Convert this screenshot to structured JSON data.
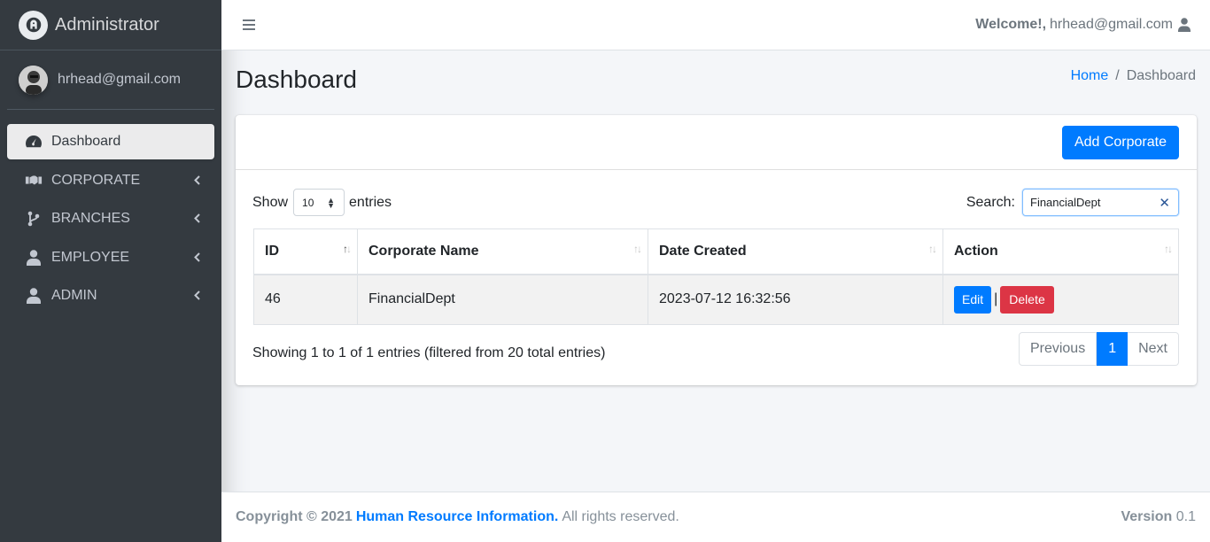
{
  "brand": {
    "name": "Administrator"
  },
  "user": {
    "email": "hrhead@gmail.com"
  },
  "sidebar": {
    "items": [
      {
        "label": "Dashboard",
        "icon": "tachometer-icon"
      },
      {
        "label": "CORPORATE",
        "icon": "handshake-icon"
      },
      {
        "label": "BRANCHES",
        "icon": "code-branch-icon"
      },
      {
        "label": "EMPLOYEE",
        "icon": "user-icon"
      },
      {
        "label": "ADMIN",
        "icon": "user-icon"
      }
    ]
  },
  "header": {
    "welcome_label": "Welcome!,",
    "welcome_user": "hrhead@gmail.com"
  },
  "page": {
    "title": "Dashboard"
  },
  "breadcrumb": {
    "home": "Home",
    "separator": "/",
    "current": "Dashboard"
  },
  "card": {
    "add_button": "Add Corporate",
    "length": {
      "show": "Show",
      "value": "10",
      "entries": "entries"
    },
    "search": {
      "label": "Search:",
      "value": "FinancialDept"
    },
    "table": {
      "columns": [
        "ID",
        "Corporate Name",
        "Date Created",
        "Action"
      ],
      "rows": [
        {
          "id": "46",
          "name": "FinancialDept",
          "date": "2023-07-12 16:32:56",
          "edit": "Edit",
          "sep": "|",
          "delete": "Delete"
        }
      ]
    },
    "info": "Showing 1 to 1 of 1 entries (filtered from 20 total entries)",
    "pagination": {
      "previous": "Previous",
      "page": "1",
      "next": "Next"
    }
  },
  "footer": {
    "copyright": "Copyright © 2021",
    "org": "Human Resource Information.",
    "rights": "All rights reserved.",
    "version_label": "Version",
    "version": "0.1"
  },
  "colors": {
    "primary": "#007bff",
    "danger": "#dc3545",
    "sidebar": "#343a40"
  }
}
